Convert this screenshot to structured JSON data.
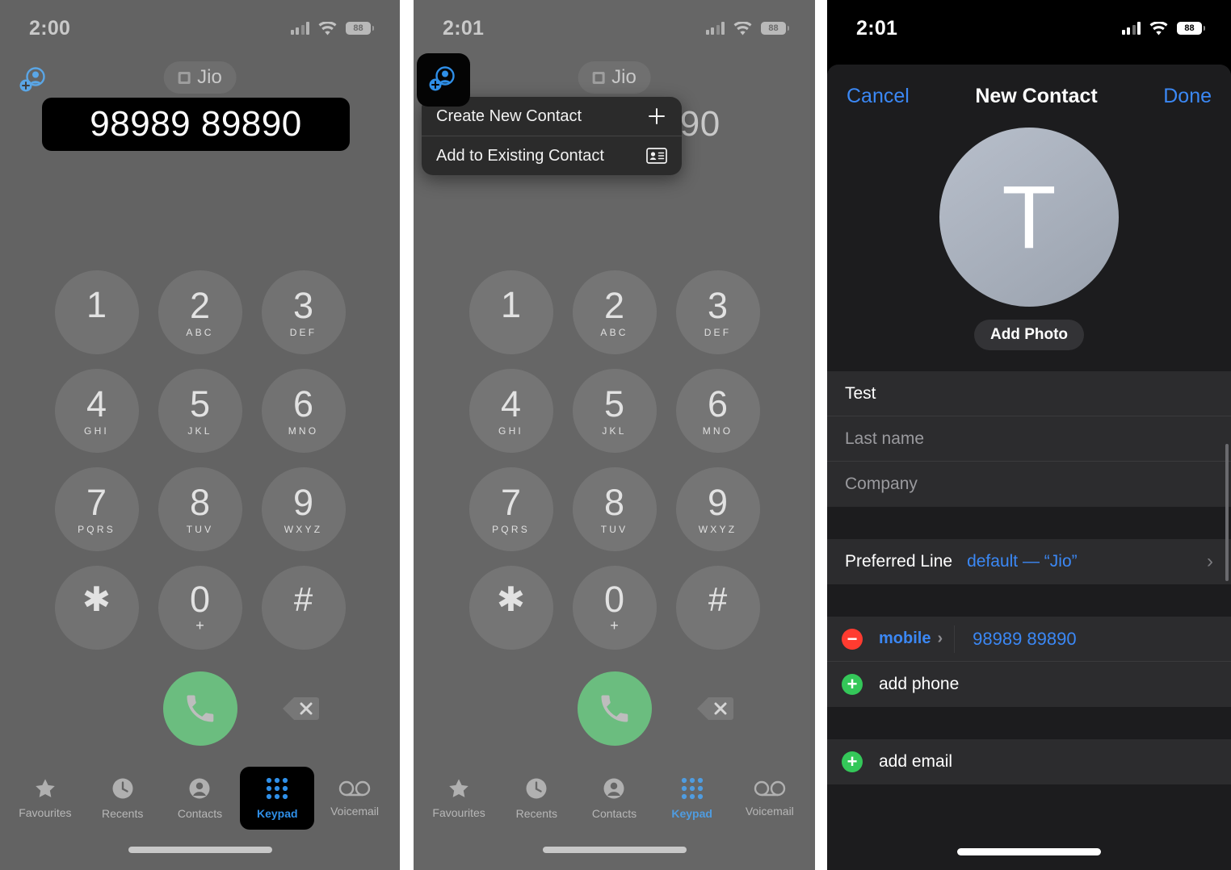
{
  "panels": [
    {
      "name": "dialer",
      "status": {
        "time": "2:00",
        "battery": "88",
        "signal_icon": "cellular-bars-icon",
        "wifi_icon": "wifi-icon",
        "battery_icon": "battery-icon"
      },
      "header": {
        "add_contact_icon": "add-contact-icon",
        "sim_label": "Jio",
        "sim_icon": "sim-card-icon"
      },
      "number": "98989 89890"
    },
    {
      "name": "dialer-with-menu",
      "status": {
        "time": "2:01",
        "battery": "88",
        "signal_icon": "cellular-bars-icon",
        "wifi_icon": "wifi-icon",
        "battery_icon": "battery-icon"
      },
      "header": {
        "add_contact_icon": "add-contact-icon",
        "sim_label": "Jio",
        "sim_icon": "sim-card-icon"
      },
      "number": "98989 89890",
      "menu": {
        "items": [
          {
            "label": "Create New Contact",
            "icon": "plus-icon"
          },
          {
            "label": "Add to Existing Contact",
            "icon": "contact-card-icon"
          }
        ]
      }
    },
    {
      "name": "new-contact",
      "status": {
        "time": "2:01",
        "battery": "88",
        "signal_icon": "cellular-bars-icon",
        "wifi_icon": "wifi-icon",
        "battery_icon": "battery-icon"
      }
    }
  ],
  "keypad": {
    "keys": [
      {
        "digit": "1",
        "letters": ""
      },
      {
        "digit": "2",
        "letters": "ABC"
      },
      {
        "digit": "3",
        "letters": "DEF"
      },
      {
        "digit": "4",
        "letters": "GHI"
      },
      {
        "digit": "5",
        "letters": "JKL"
      },
      {
        "digit": "6",
        "letters": "MNO"
      },
      {
        "digit": "7",
        "letters": "PQRS"
      },
      {
        "digit": "8",
        "letters": "TUV"
      },
      {
        "digit": "9",
        "letters": "WXYZ"
      },
      {
        "digit": "✱",
        "letters": ""
      },
      {
        "digit": "0",
        "letters": "+"
      },
      {
        "digit": "#",
        "letters": ""
      }
    ],
    "call_button_icon": "phone-call-icon",
    "delete_button_icon": "backspace-delete-icon"
  },
  "tabbar": {
    "items": [
      {
        "label": "Favourites",
        "icon": "star-icon",
        "active": false
      },
      {
        "label": "Recents",
        "icon": "clock-icon",
        "active": false
      },
      {
        "label": "Contacts",
        "icon": "person-circle-icon",
        "active": false
      },
      {
        "label": "Keypad",
        "icon": "keypad-grid-icon",
        "active": true
      },
      {
        "label": "Voicemail",
        "icon": "voicemail-icon",
        "active": false
      }
    ]
  },
  "new_contact": {
    "nav": {
      "cancel": "Cancel",
      "title": "New Contact",
      "done": "Done"
    },
    "avatar_initial": "T",
    "add_photo": "Add Photo",
    "fields": [
      {
        "name": "first-name",
        "value": "Test",
        "is_placeholder": false
      },
      {
        "name": "last-name",
        "value": "Last name",
        "is_placeholder": true
      },
      {
        "name": "company",
        "value": "Company",
        "is_placeholder": true
      }
    ],
    "preferred_line": {
      "label": "Preferred Line",
      "value": "default — “Jio”",
      "chevron": "›"
    },
    "phone": {
      "type": "mobile",
      "chevron": "›",
      "number": "98989 89890",
      "remove_icon": "minus-circle-icon"
    },
    "add_phone": {
      "label": "add phone",
      "icon": "plus-circle-icon"
    },
    "add_email": {
      "label": "add email",
      "icon": "plus-circle-icon"
    }
  },
  "colors": {
    "accent_blue": "#3b88f5",
    "call_green": "#6bbd7f",
    "remove_red": "#ff3b30",
    "add_green": "#34c759",
    "sheet_bg": "#1c1c1e",
    "group_bg": "#2c2c2e"
  }
}
